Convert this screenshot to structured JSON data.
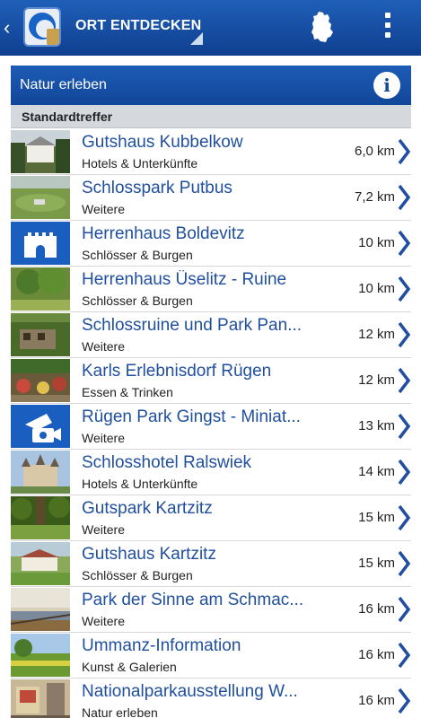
{
  "actionbar": {
    "back_icon": "chevron-left-icon",
    "logo_icon": "app-logo-icon",
    "title": "ORT ENTDECKEN",
    "map_icon": "germany-map-icon",
    "menu_icon": "overflow-menu-icon"
  },
  "section": {
    "title": "Natur erleben",
    "info_icon": "info-icon",
    "info_glyph": "i"
  },
  "group": {
    "title": "Standardtreffer"
  },
  "colors": {
    "accent": "#1f5fb8",
    "link": "#1f4f9e"
  },
  "items": [
    {
      "name": "Gutshaus Kubbelkow",
      "category": "Hotels & Unterkünfte",
      "distance": "6,0 km",
      "thumb": "photo-manor"
    },
    {
      "name": "Schlosspark Putbus",
      "category": "Weitere",
      "distance": "7,2 km",
      "thumb": "photo-aerial-park"
    },
    {
      "name": "Herrenhaus Boldevitz",
      "category": "Schlösser & Burgen",
      "distance": "10 km",
      "thumb": "castle-icon"
    },
    {
      "name": "Herrenhaus Üselitz - Ruine",
      "category": "Schlösser & Burgen",
      "distance": "10 km",
      "thumb": "photo-trees"
    },
    {
      "name": "Schlossruine und Park Pan...",
      "category": "Weitere",
      "distance": "12 km",
      "thumb": "photo-ruin"
    },
    {
      "name": "Karls Erlebnisdorf Rügen",
      "category": "Essen & Trinken",
      "distance": "12 km",
      "thumb": "photo-village"
    },
    {
      "name": "Rügen Park Gingst - Miniat...",
      "category": "Weitere",
      "distance": "13 km",
      "thumb": "camera-icon"
    },
    {
      "name": "Schlosshotel Ralswiek",
      "category": "Hotels & Unterkünfte",
      "distance": "14 km",
      "thumb": "photo-castle-hotel"
    },
    {
      "name": "Gutspark Kartzitz",
      "category": "Weitere",
      "distance": "15 km",
      "thumb": "photo-park"
    },
    {
      "name": "Gutshaus Kartzitz",
      "category": "Schlösser & Burgen",
      "distance": "15 km",
      "thumb": "photo-house"
    },
    {
      "name": "Park der Sinne am Schmac...",
      "category": "Weitere",
      "distance": "16 km",
      "thumb": "photo-lake"
    },
    {
      "name": "Ummanz-Information",
      "category": "Kunst & Galerien",
      "distance": "16 km",
      "thumb": "photo-field"
    },
    {
      "name": "Nationalparkausstellung W...",
      "category": "Natur erleben",
      "distance": "16 km",
      "thumb": "photo-exhibit"
    }
  ]
}
